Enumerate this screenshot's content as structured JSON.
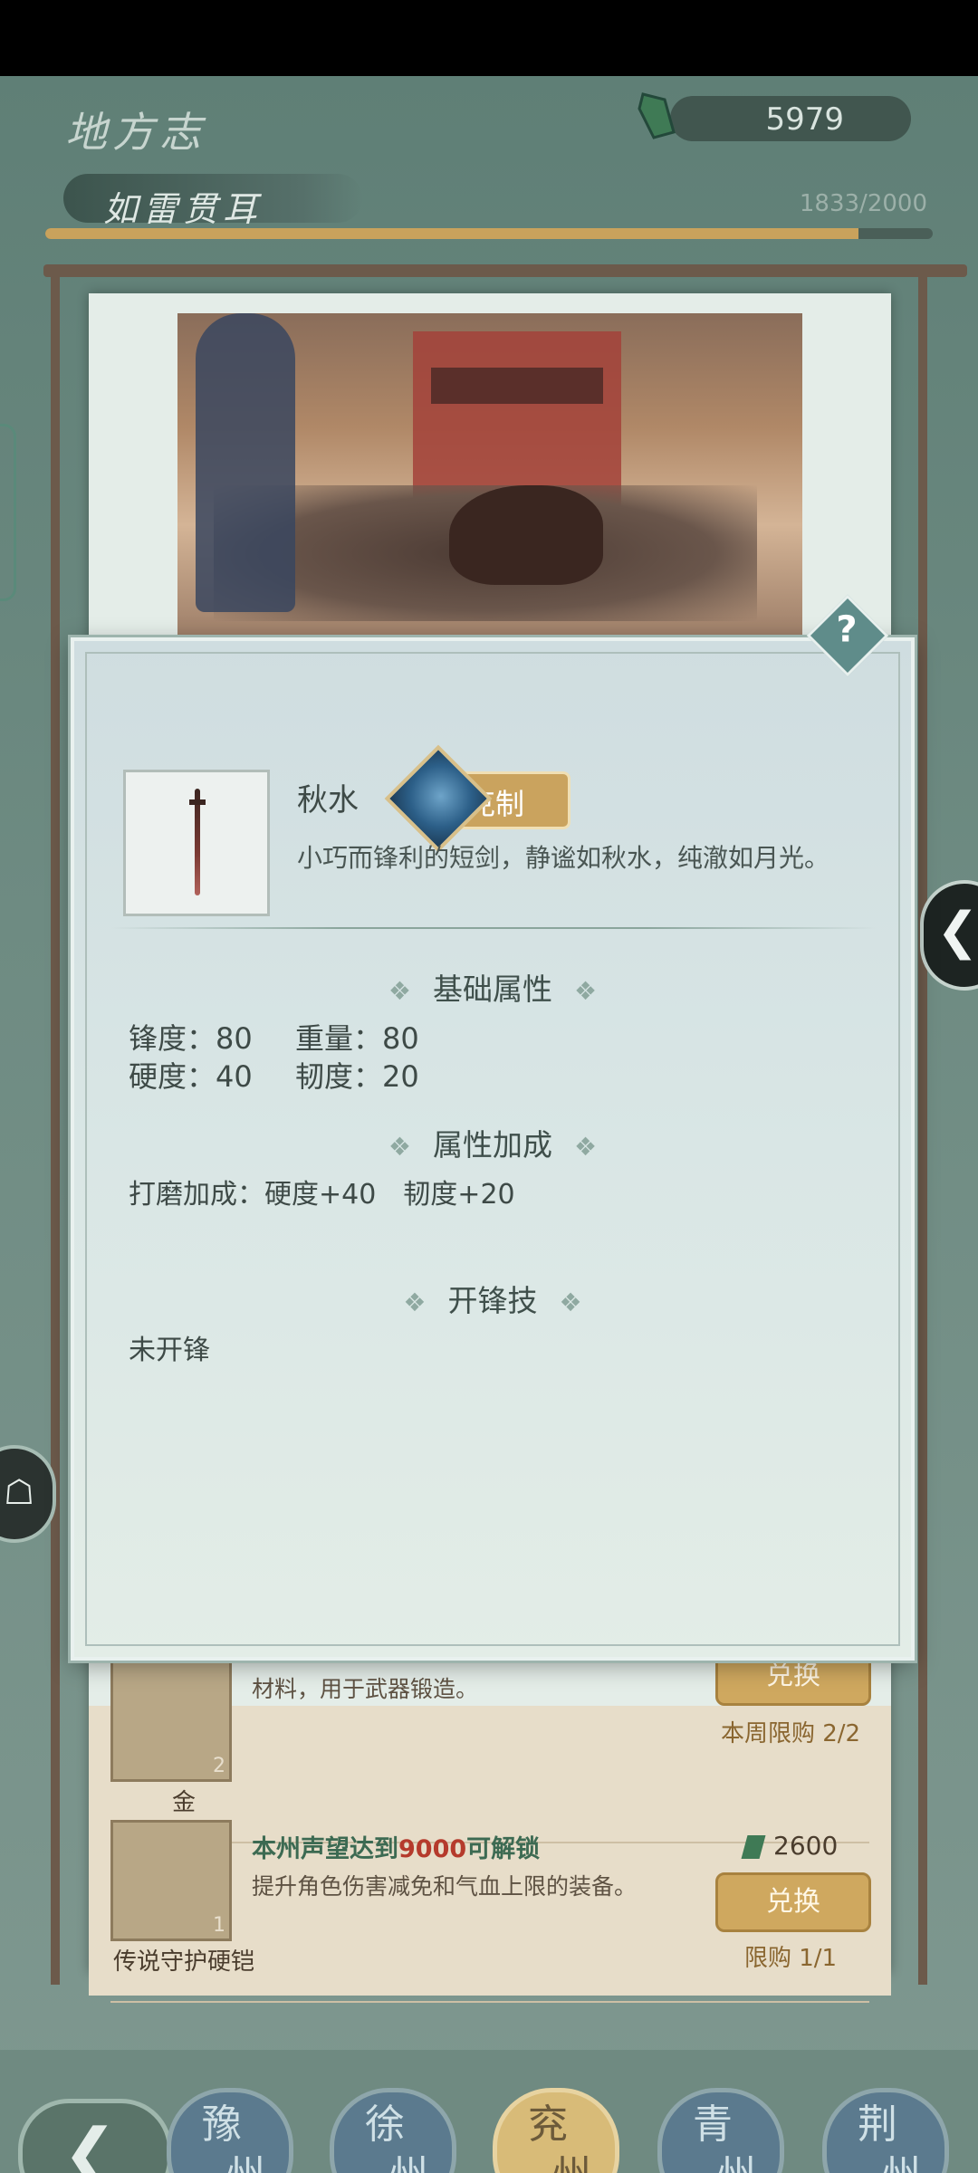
{
  "header": {
    "title": "地方志",
    "subtitle": "如雷贯耳",
    "currency_value": "5979",
    "progress_text": "1833/2000",
    "progress_fraction": 0.9165
  },
  "modal": {
    "item_name": "秋水",
    "counter_label": "克制",
    "description": "小巧而锋利的短剑，静谧如秋水，纯澈如月光。",
    "help_label": "?",
    "sections": {
      "basic": "基础属性",
      "bonus": "属性加成",
      "skill": "开锋技"
    },
    "ornament": "❖",
    "stats": {
      "sharpness": "锋度：80",
      "weight": "重量：80",
      "hardness": "硬度：40",
      "toughness": "韧度：20"
    },
    "bonus_text": "打磨加成：硬度+40　韧度+20",
    "skill_text": "未开锋"
  },
  "shop": {
    "items": [
      {
        "name": "金",
        "qty": "2",
        "desc": "材料，用于武器锻造。",
        "button": "兑换",
        "limit": "本周限购 2/2"
      },
      {
        "name": "传说守护硬铠",
        "qty": "1",
        "unlock_pre": "本州声望达到",
        "unlock_num": "9000",
        "unlock_post": "可解锁",
        "desc": "提升角色伤害减免和气血上限的装备。",
        "price": "2600",
        "button": "兑换",
        "limit": "限购 1/1"
      }
    ]
  },
  "nav": {
    "back_glyph": "❮",
    "regions": [
      {
        "c1": "豫",
        "c2": "州"
      },
      {
        "c1": "徐",
        "c2": "州"
      },
      {
        "c1": "兖",
        "c2": "州"
      },
      {
        "c1": "青",
        "c2": "州"
      },
      {
        "c1": "荆",
        "c2": "州"
      }
    ]
  },
  "side": {
    "right_arrow": "❮",
    "left_icon": "☖"
  },
  "colors": {
    "accent_gold": "#caa35e",
    "panel": "#d9e6e5",
    "unlock_red": "#b53a2c"
  }
}
